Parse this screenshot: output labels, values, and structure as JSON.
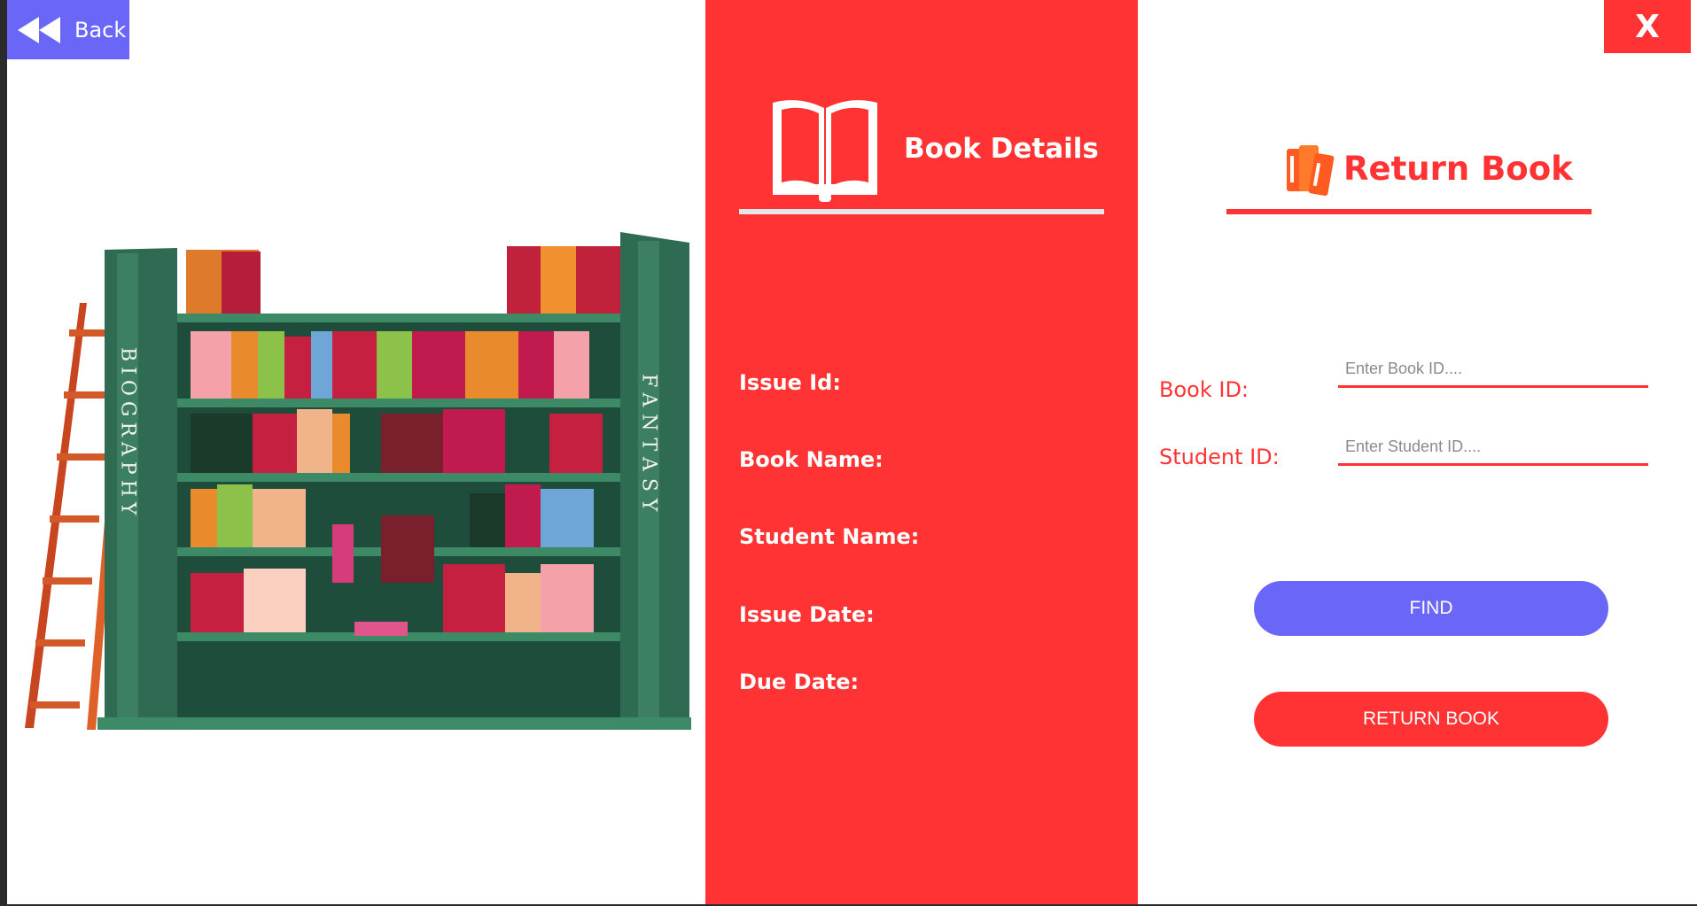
{
  "nav": {
    "back_label": "Back",
    "close_label": "X"
  },
  "shelf": {
    "left_sign": "BIOGRAPHY",
    "right_sign": "FANTASY"
  },
  "details": {
    "title": "Book Details",
    "labels": [
      "Issue Id:",
      "Book Name:",
      "Student Name:",
      "Issue Date:",
      "Due Date:"
    ]
  },
  "return_form": {
    "title": "Return Book",
    "book_id_label": "Book ID:",
    "book_id_placeholder": "Enter Book ID....",
    "student_id_label": "Student ID:",
    "student_id_placeholder": "Enter Student ID....",
    "find_label": "FIND",
    "return_label": "RETURN BOOK"
  },
  "colors": {
    "accent_red": "#ff3333",
    "accent_blue": "#6a66f7",
    "shelf_green": "#2f6b52"
  },
  "icons": {
    "back": "rewind-icon",
    "details": "open-book-icon",
    "return": "books-icon"
  }
}
